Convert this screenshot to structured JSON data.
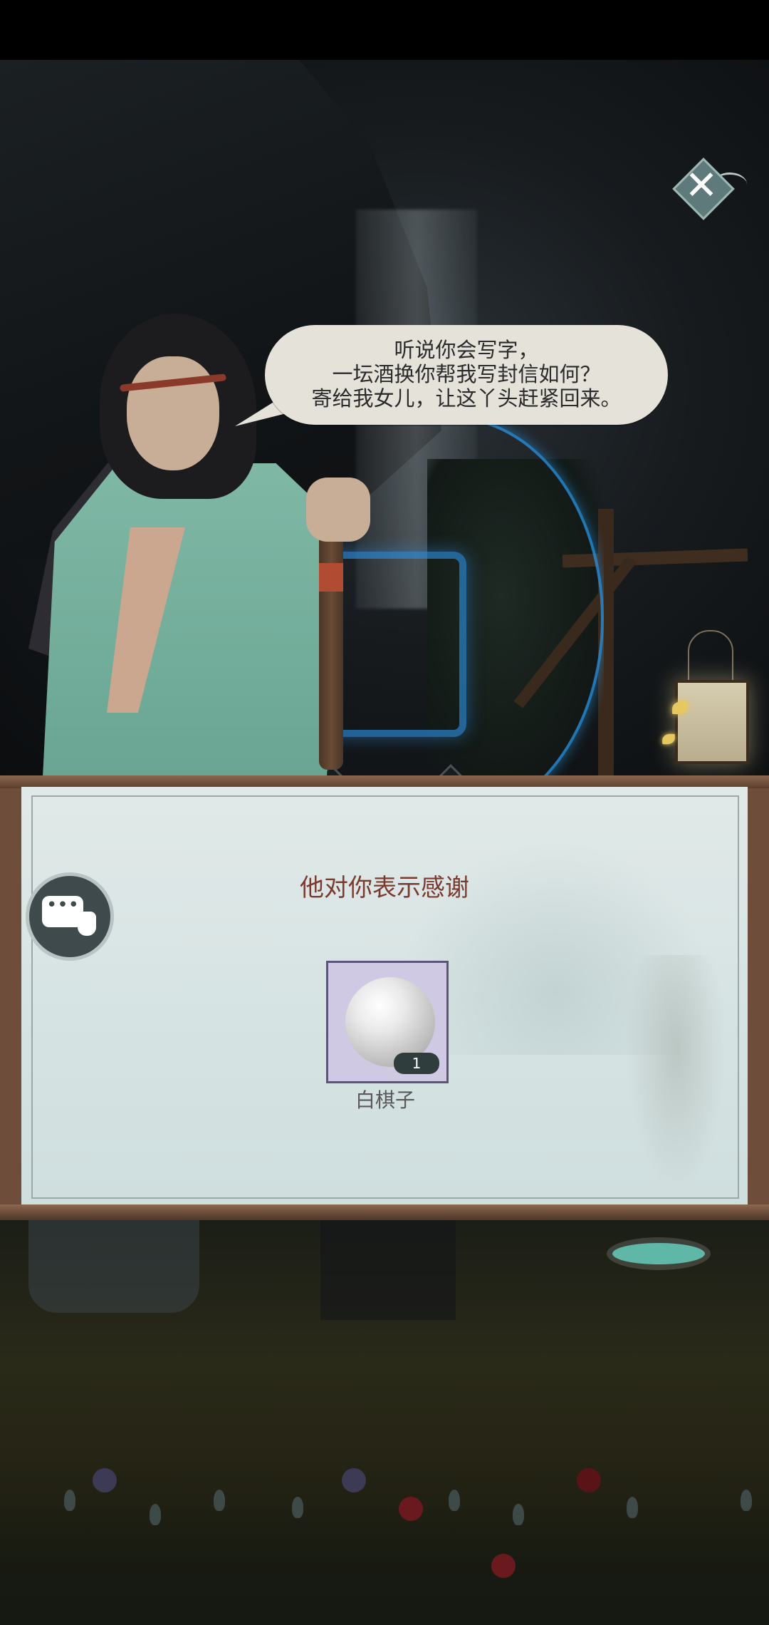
{
  "dialogue": {
    "lines": [
      "听说你会写字，",
      "一坛酒换你帮我写封信如何？",
      "寄给我女儿，让这丫头赶紧回来。"
    ]
  },
  "reward_panel": {
    "title": "他对你表示感谢",
    "item": {
      "name": "白棋子",
      "quantity": "1",
      "icon": "white-go-stone-icon"
    }
  },
  "controls": {
    "close_icon": "close-x-icon",
    "chat_icon": "chat-bubble-icon"
  },
  "colors": {
    "title_text": "#7a3b2e",
    "frame": "#6e4d3a",
    "paper": "#d6e3e3",
    "glow": "#2896e6"
  }
}
